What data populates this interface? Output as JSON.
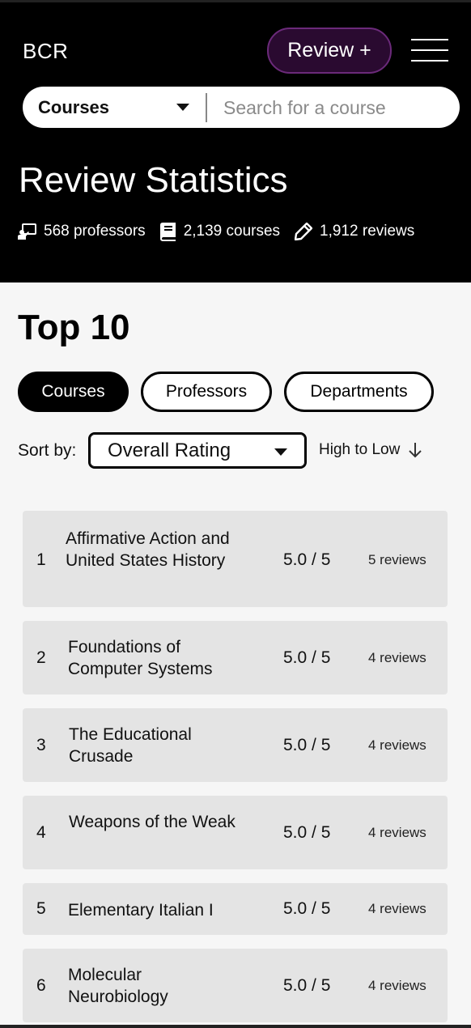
{
  "header": {
    "brand": "BCR",
    "review_button": "Review +",
    "search": {
      "type_selected": "Courses",
      "placeholder": "Search for a course"
    }
  },
  "stats": {
    "title": "Review Statistics",
    "professors": "568 professors",
    "courses": "2,139 courses",
    "reviews": "1,912 reviews"
  },
  "top10": {
    "title": "Top 10",
    "tabs": [
      {
        "label": "Courses",
        "active": true
      },
      {
        "label": "Professors",
        "active": false
      },
      {
        "label": "Departments",
        "active": false
      }
    ],
    "sort_label": "Sort by:",
    "sort_selected": "Overall Rating",
    "order_label": "High to Low",
    "items": [
      {
        "rank": "1",
        "name": "Affirmative Action and United States History",
        "rating": "5.0 / 5",
        "reviews": "5 reviews"
      },
      {
        "rank": "2",
        "name": "Foundations of Computer Systems",
        "rating": "5.0 / 5",
        "reviews": "4 reviews"
      },
      {
        "rank": "3",
        "name": "The Educational Crusade",
        "rating": "5.0 / 5",
        "reviews": "4 reviews"
      },
      {
        "rank": "4",
        "name": "Weapons of the Weak",
        "rating": "5.0 / 5",
        "reviews": "4 reviews"
      },
      {
        "rank": "5",
        "name": "Elementary Italian I",
        "rating": "5.0 / 5",
        "reviews": "4 reviews"
      },
      {
        "rank": "6",
        "name": "Molecular Neurobiology",
        "rating": "5.0 / 5",
        "reviews": "4 reviews"
      }
    ]
  },
  "icons": {
    "professors": "teacher-icon",
    "courses": "book-icon",
    "reviews": "pencil-icon",
    "menu": "hamburger-menu-icon",
    "order": "arrow-down-icon"
  }
}
